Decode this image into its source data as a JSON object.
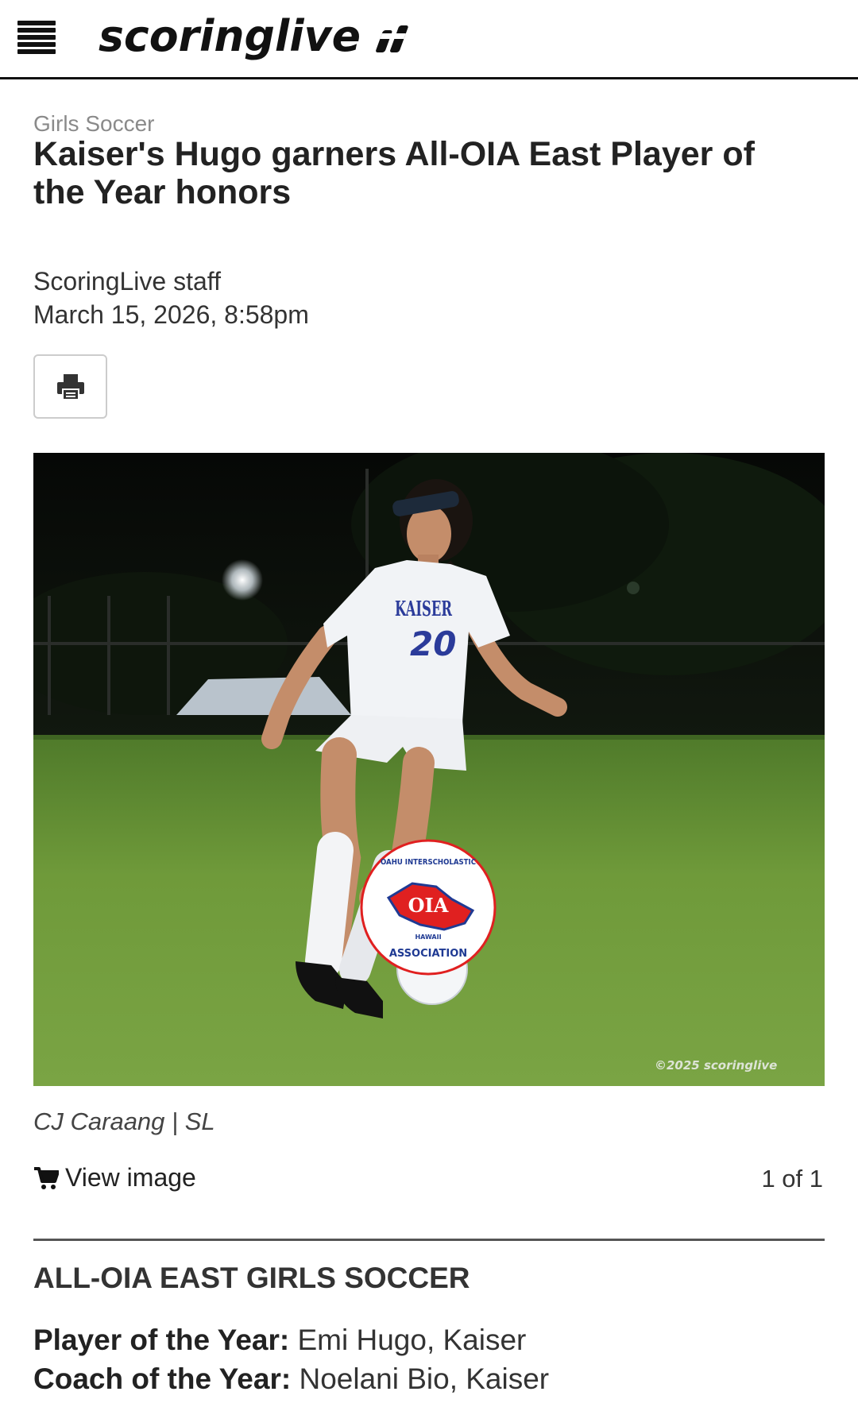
{
  "header": {
    "logo_text": "scoringlive",
    "menu_icon": "hamburger-menu-icon"
  },
  "article": {
    "category": "Girls Soccer",
    "title": "Kaiser's Hugo garners All-OIA East Player of the Year honors",
    "author": "ScoringLive staff",
    "date": "March 15, 2026, 8:58pm"
  },
  "toolbar": {
    "print_icon": "printer-icon"
  },
  "photo": {
    "jersey_text": "KAISER",
    "jersey_number": "20",
    "badge_text_top": "OAHU INTERSCHOLASTIC",
    "badge_center": "OIA",
    "badge_text_hawaii": "HAWAII",
    "badge_text_bottom": "ASSOCIATION",
    "watermark": "©2025 scoringlive",
    "caption": "CJ Caraang | SL",
    "view_label": "View image",
    "counter": "1 of 1"
  },
  "section": {
    "title": "ALL-OIA EAST GIRLS SOCCER",
    "awards": [
      {
        "label": "Player of the Year:",
        "value": "Emi Hugo, Kaiser"
      },
      {
        "label": "Coach of the Year:",
        "value": "Noelani Bio, Kaiser"
      }
    ]
  },
  "colors": {
    "text_dark": "#222222",
    "text_muted": "#8a8a8a",
    "badge_red": "#e02020",
    "badge_blue": "#1f3a93",
    "grass": "#6f9a3a"
  }
}
